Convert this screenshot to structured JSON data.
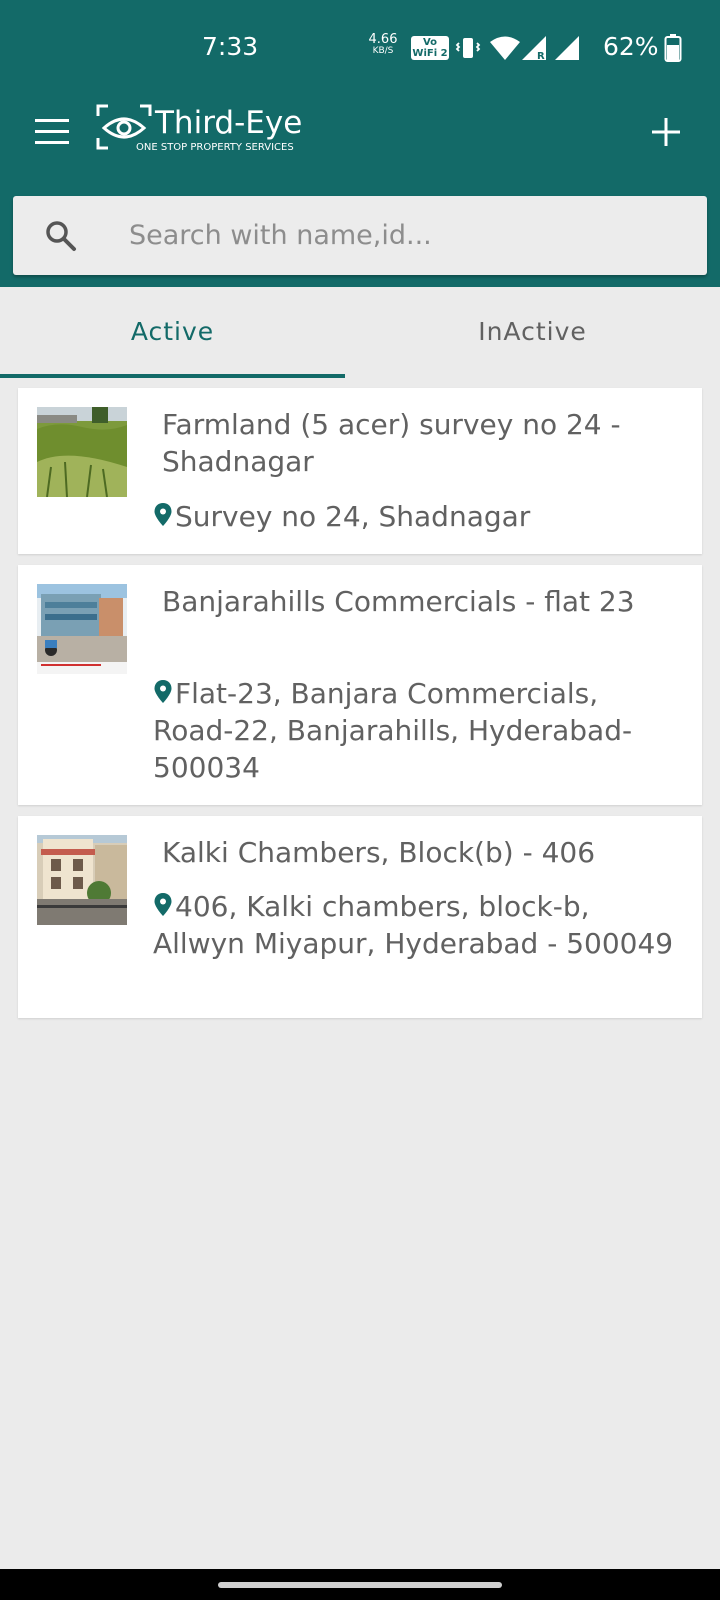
{
  "status_bar": {
    "time": "7:33",
    "net_speed_value": "4.66",
    "net_speed_unit": "KB/S",
    "vowifi_line1": "Vo",
    "vowifi_line2": "WiFi 2",
    "battery": "62%",
    "icons": [
      "vibrate-icon",
      "wifi-icon",
      "signal-roaming-icon",
      "signal-icon",
      "battery-icon"
    ]
  },
  "app_bar": {
    "logo_title": "Third-Eye",
    "logo_tagline": "ONE STOP PROPERTY SERVICES",
    "menu_icon": "hamburger-icon",
    "add_icon": "plus-icon"
  },
  "search": {
    "placeholder": "Search with name,id..."
  },
  "tabs": [
    {
      "label": "Active",
      "selected": true
    },
    {
      "label": "InActive",
      "selected": false
    }
  ],
  "properties": [
    {
      "title": "Farmland (5 acer) survey no 24 - Shadnagar",
      "address": "Survey no 24, Shadnagar"
    },
    {
      "title": "Banjarahills Commercials - flat 23",
      "address": "Flat-23, Banjara Commercials, Road-22, Banjarahills, Hyderabad-500034"
    },
    {
      "title": "Kalki Chambers, Block(b) - 406",
      "address": "406, Kalki chambers, block-b, Allwyn Miyapur, Hyderabad - 500049"
    }
  ],
  "colors": {
    "primary": "#136a68",
    "background": "#ebebeb",
    "card": "#ffffff",
    "text_secondary": "#616161"
  }
}
